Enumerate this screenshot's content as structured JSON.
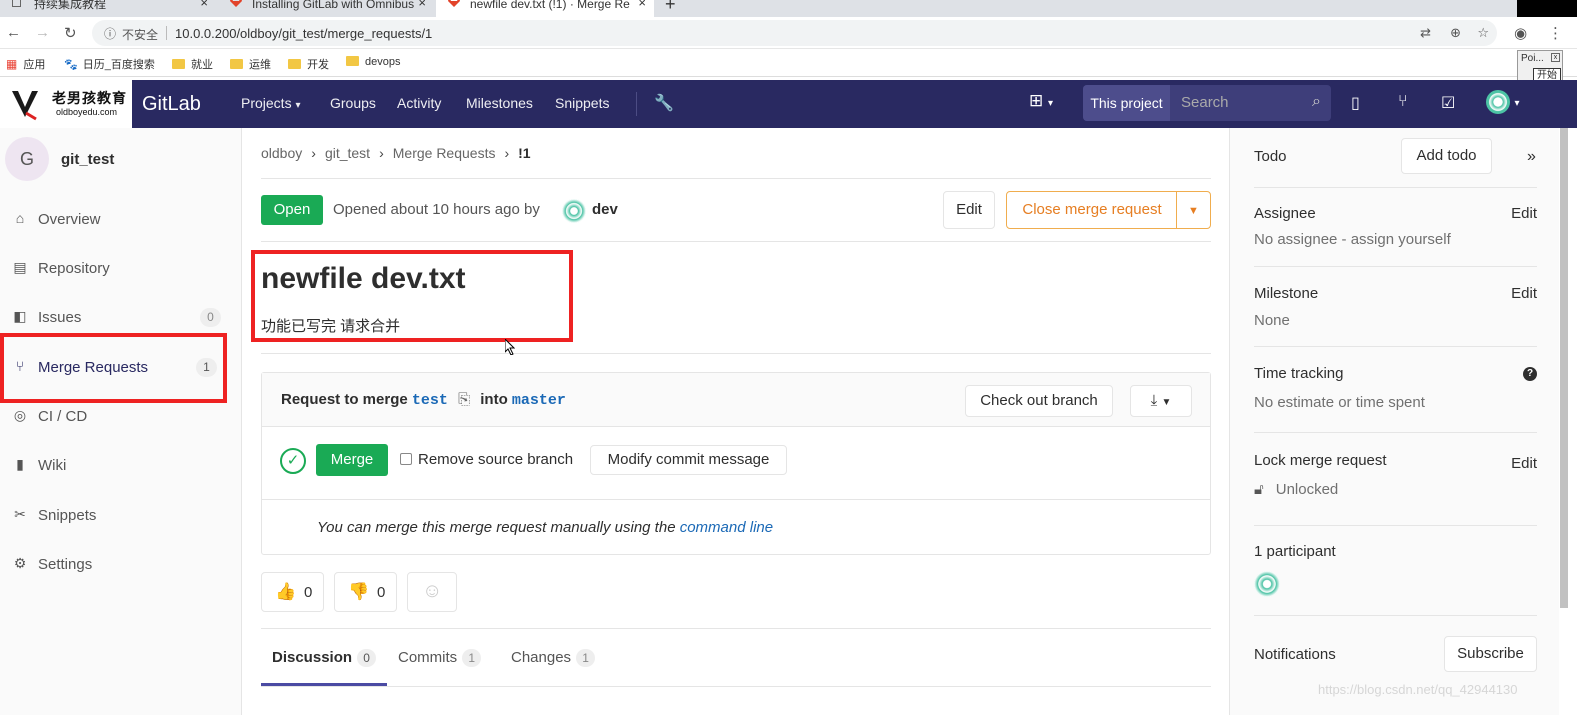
{
  "browser": {
    "tabs": [
      {
        "title": "持续集成教程",
        "close": "×"
      },
      {
        "title": "Installing GitLab with Omnibus",
        "close": "×"
      },
      {
        "title": "newfile dev.txt (!1) · Merge Re",
        "close": "×"
      }
    ],
    "new_tab": "+",
    "insecure_label": "不安全",
    "url": "10.0.0.200/oldboy/git_test/merge_requests/1",
    "bookmarks": [
      "应用",
      "日历_百度搜索",
      "就业",
      "运维",
      "开发",
      "devops"
    ],
    "popup": {
      "title": "Poi...",
      "close": "x",
      "button": "开始"
    }
  },
  "gitlab_nav": {
    "logo_cn": "老男孩教育",
    "logo_en": "oldboyedu.com",
    "brand": "GitLab",
    "links": [
      "Projects",
      "Groups",
      "Activity",
      "Milestones",
      "Snippets"
    ],
    "search_scope": "This project",
    "search_placeholder": "Search"
  },
  "sidebar": {
    "avatar_letter": "G",
    "project_name": "git_test",
    "items": [
      {
        "label": "Overview",
        "icon": "home-icon"
      },
      {
        "label": "Repository",
        "icon": "doc-icon"
      },
      {
        "label": "Issues",
        "icon": "issues-icon",
        "count": "0"
      },
      {
        "label": "Merge Requests",
        "icon": "merge-icon",
        "count": "1"
      },
      {
        "label": "CI / CD",
        "icon": "rocket-icon"
      },
      {
        "label": "Wiki",
        "icon": "book-icon"
      },
      {
        "label": "Snippets",
        "icon": "scissors-icon"
      },
      {
        "label": "Settings",
        "icon": "gear-icon"
      }
    ]
  },
  "content": {
    "breadcrumb": [
      "oldboy",
      "git_test",
      "Merge Requests",
      "!1"
    ],
    "status": "Open",
    "opened_text": "Opened about 10 hours ago by",
    "author": "dev",
    "edit_label": "Edit",
    "close_label": "Close merge request",
    "title": "newfile dev.txt",
    "description": "功能已写完 请求合并",
    "widget": {
      "request_text": "Request to merge",
      "source": "test",
      "into_text": "into",
      "target": "master",
      "checkout_label": "Check out branch",
      "merge_label": "Merge",
      "remove_source_label": "Remove source branch",
      "modify_commit_label": "Modify commit message",
      "manual_text": "You can merge this merge request manually using the",
      "command_line": "command line"
    },
    "thumbs_up": "0",
    "thumbs_down": "0",
    "tabs": [
      {
        "label": "Discussion",
        "count": "0"
      },
      {
        "label": "Commits",
        "count": "1"
      },
      {
        "label": "Changes",
        "count": "1"
      }
    ]
  },
  "right_sidebar": {
    "todo": "Todo",
    "add_todo": "Add todo",
    "assignee_title": "Assignee",
    "assignee_value": "No assignee - assign yourself",
    "milestone_title": "Milestone",
    "milestone_value": "None",
    "time_title": "Time tracking",
    "time_value": "No estimate or time spent",
    "lock_title": "Lock merge request",
    "lock_value": "Unlocked",
    "participants": "1 participant",
    "notifications": "Notifications",
    "subscribe": "Subscribe",
    "edit": "Edit"
  },
  "watermark": "https://blog.csdn.net/qq_42944130",
  "colors": {
    "nav": "#292961",
    "green": "#1aaa55",
    "highlight": "#ee2222",
    "warn": "#f0ad4e"
  }
}
